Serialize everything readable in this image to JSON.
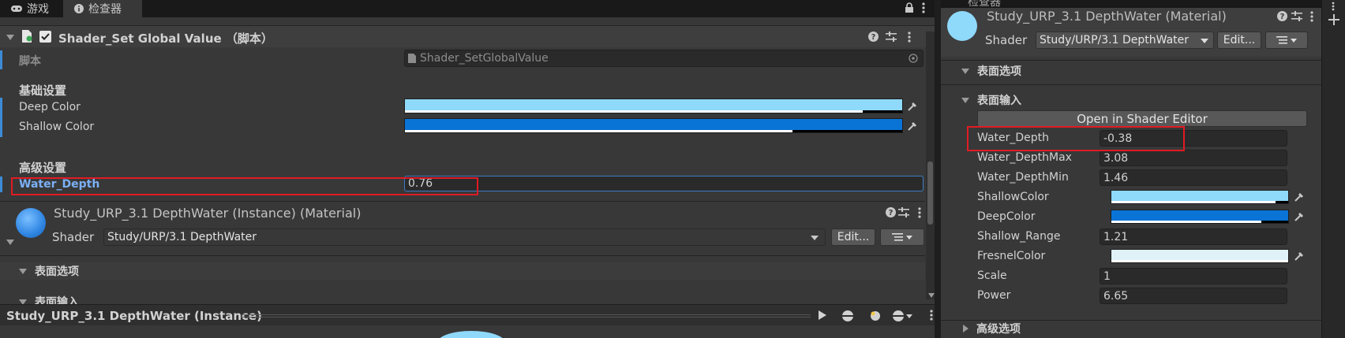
{
  "left": {
    "tabs": [
      {
        "label": "游戏",
        "icon": "gamepad-icon"
      },
      {
        "label": "检查器",
        "icon": "info-icon"
      }
    ],
    "component": {
      "title": "Shader_Set Global Value （脚本）",
      "enabled": true,
      "script_label": "脚本",
      "script_value": "Shader_SetGlobalValue",
      "basic_header": "基础设置",
      "deep_color_label": "Deep Color",
      "deep_color": "#8fd9fa",
      "shallow_color_label": "Shallow Color",
      "shallow_color": "#0a74d6",
      "advanced_header": "高级设置",
      "water_depth_label": "Water_Depth",
      "water_depth_value": "0.76"
    },
    "material": {
      "name": "Study_URP_3.1 DepthWater (Instance) (Material)",
      "shader_label": "Shader",
      "shader_value": "Study/URP/3.1 DepthWater",
      "edit_label": "Edit...",
      "surface_options": "表面选项",
      "surface_inputs": "表面输入"
    },
    "preview": {
      "title": "Study_URP_3.1 DepthWater (Instance)"
    }
  },
  "right": {
    "tab_label": "检查器",
    "material_name": "Study_URP_3.1 DepthWater (Material)",
    "shader_label": "Shader",
    "shader_value": "Study/URP/3.1 DepthWater",
    "edit_label": "Edit...",
    "surface_options": "表面选项",
    "surface_inputs": "表面输入",
    "open_editor_label": "Open in Shader Editor",
    "properties": [
      {
        "label": "Water_Depth",
        "value": "-0.38"
      },
      {
        "label": "Water_DepthMax",
        "value": "3.08"
      },
      {
        "label": "Water_DepthMin",
        "value": "1.46"
      },
      {
        "label": "ShallowColor",
        "color": "#8fd9fa",
        "alpha_fraction": 0.93
      },
      {
        "label": "DeepColor",
        "color": "#0a74d6",
        "alpha_fraction": 0.85
      },
      {
        "label": "Shallow_Range",
        "value": "1.21"
      },
      {
        "label": "FresnelColor",
        "color": "#dff2f7",
        "alpha_fraction": 1.0
      },
      {
        "label": "Scale",
        "value": "1"
      },
      {
        "label": "Power",
        "value": "6.65"
      }
    ],
    "advanced_options": "高级选项"
  },
  "colors": {
    "accent_blue": "#3d8bd6",
    "highlight_red": "#e01b24",
    "link_blue": "#7bb0f5"
  }
}
